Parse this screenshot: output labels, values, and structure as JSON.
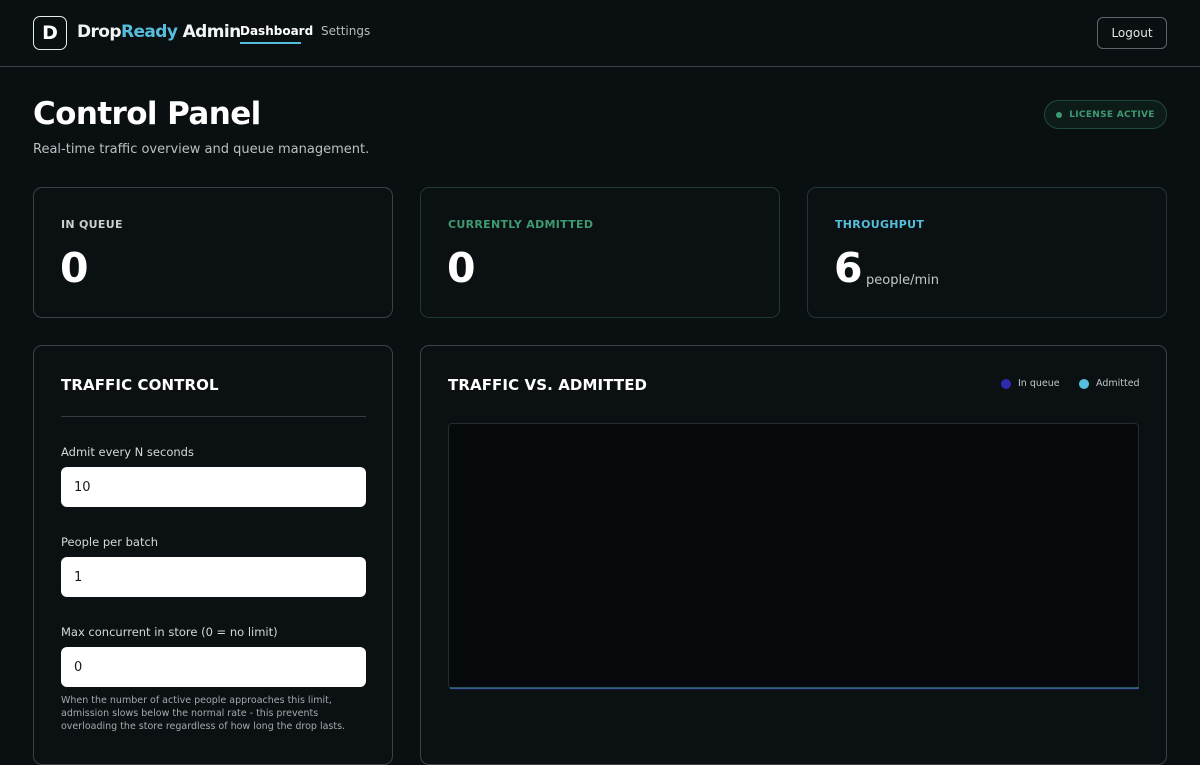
{
  "app": {
    "logo_letter": "D",
    "brand_part1": "Drop",
    "brand_part2": "Ready",
    "brand_part3": " Admin"
  },
  "nav": {
    "tabs": [
      {
        "label": "Dashboard",
        "active": true
      },
      {
        "label": "Settings",
        "active": false
      }
    ],
    "logout_label": "Logout"
  },
  "header": {
    "title": "Control Panel",
    "subtitle": "Real-time traffic overview and queue management.",
    "license_label": "LICENSE ACTIVE"
  },
  "stats": [
    {
      "label": "IN QUEUE",
      "value": "0",
      "unit": "",
      "label_color": "#c9cfd1"
    },
    {
      "label": "CURRENTLY ADMITTED",
      "value": "0",
      "unit": "",
      "label_color": "#3e9a73"
    },
    {
      "label": "THROUGHPUT",
      "value": "6",
      "unit": "people/min",
      "label_color": "#56bedc"
    }
  ],
  "traffic_control": {
    "title": "TRAFFIC CONTROL",
    "fields": [
      {
        "label": "Admit every N seconds",
        "value": "10"
      },
      {
        "label": "People per batch",
        "value": "1"
      },
      {
        "label": "Max concurrent in store (0 = no limit)",
        "value": "0"
      }
    ],
    "help_text": "When the number of active people approaches this limit, admission slows below the normal rate - this prevents overloading the store regardless of how long the drop lasts."
  },
  "chart_panel": {
    "title": "TRAFFIC VS. ADMITTED",
    "legend": [
      {
        "label": "In queue",
        "color": "#2e2ab0"
      },
      {
        "label": "Admitted",
        "color": "#56bedc"
      }
    ]
  },
  "chart_data": {
    "type": "area",
    "title": "TRAFFIC VS. ADMITTED",
    "series": [
      {
        "name": "In queue",
        "values": []
      },
      {
        "name": "Admitted",
        "values": []
      }
    ],
    "grid": false,
    "legend_position": "top-right"
  },
  "colors": {
    "background": "#0a0f11",
    "accent": "#56bedc",
    "success": "#3e9a73",
    "queue": "#2e2ab0"
  }
}
